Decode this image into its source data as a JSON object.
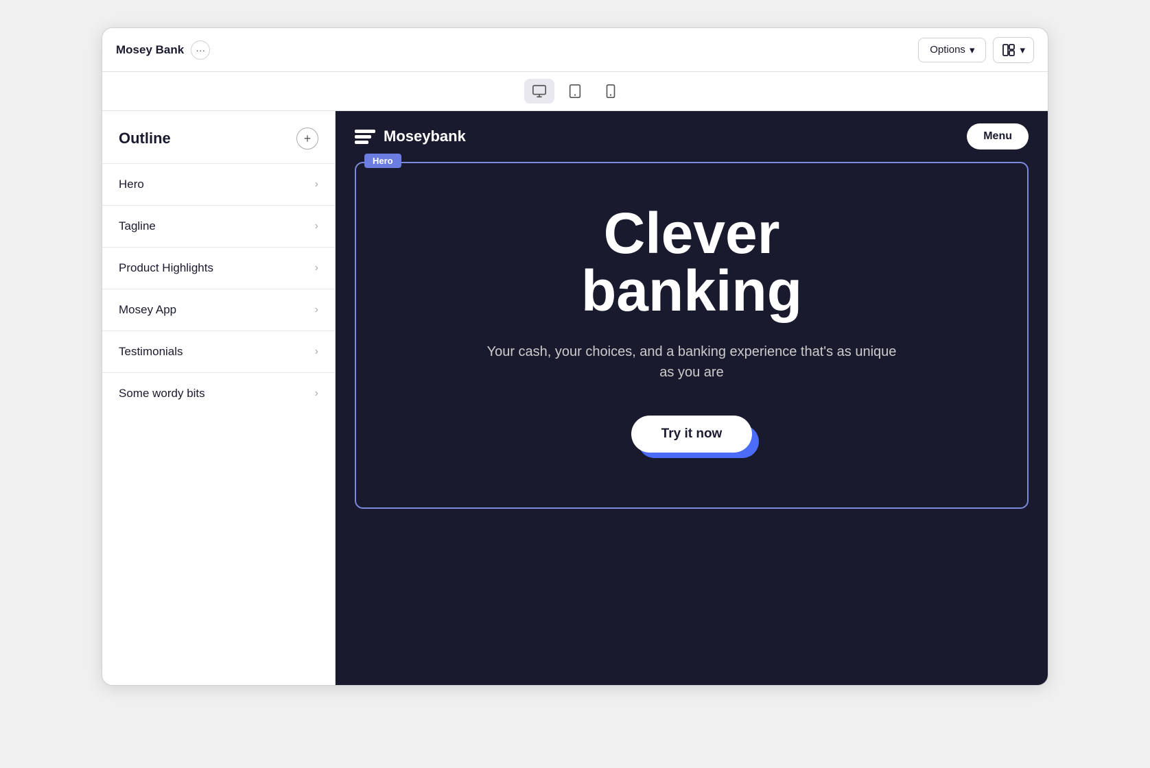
{
  "window": {
    "title": "Mosey Bank"
  },
  "topbar": {
    "app_title": "Mosey Bank",
    "options_label": "Options",
    "chevron_down": "▾"
  },
  "device_toolbar": {
    "desktop_label": "Desktop",
    "tablet_label": "Tablet",
    "phone_label": "Phone"
  },
  "sidebar": {
    "title": "Outline",
    "items": [
      {
        "label": "Hero"
      },
      {
        "label": "Tagline"
      },
      {
        "label": "Product Highlights"
      },
      {
        "label": "Mosey App"
      },
      {
        "label": "Testimonials"
      },
      {
        "label": "Some wordy bits"
      }
    ]
  },
  "preview": {
    "logo_text": "Moseybank",
    "menu_label": "Menu",
    "hero_label": "Hero",
    "hero_title_line1": "Clever",
    "hero_title_line2": "banking",
    "hero_subtitle": "Your cash, your choices, and a banking experience that's as unique as you are",
    "try_btn_label": "Try it now"
  },
  "colors": {
    "dark_bg": "#1a1a2e",
    "accent_blue": "#4a6cf7",
    "hero_border": "#7b8cde"
  }
}
